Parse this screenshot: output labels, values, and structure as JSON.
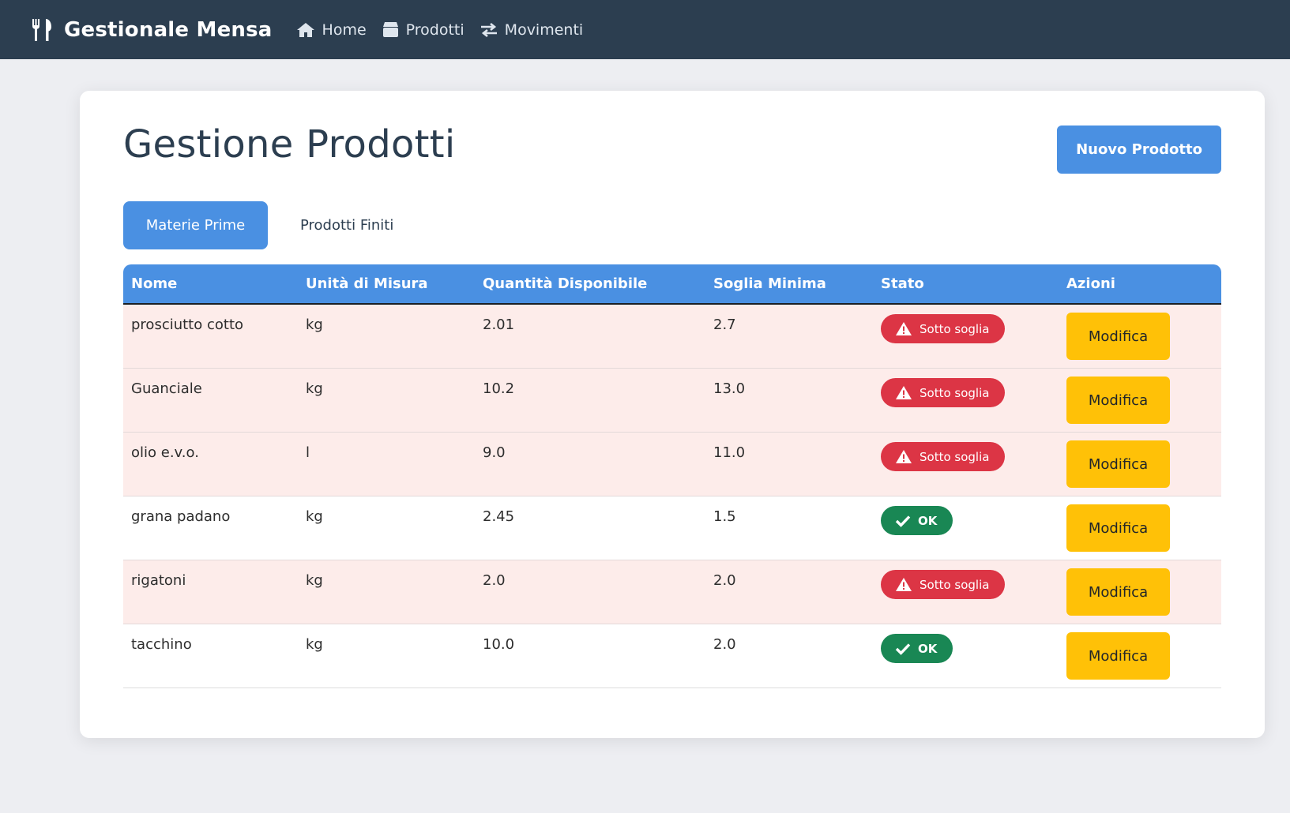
{
  "nav": {
    "brand": "Gestionale Mensa",
    "links": [
      {
        "label": "Home",
        "icon": "home-icon"
      },
      {
        "label": "Prodotti",
        "icon": "box-icon"
      },
      {
        "label": "Movimenti",
        "icon": "exchange-icon"
      }
    ]
  },
  "main": {
    "title": "Gestione Prodotti",
    "new_button": "Nuovo Prodotto",
    "tabs": [
      {
        "label": "Materie Prime",
        "active": true
      },
      {
        "label": "Prodotti Finiti",
        "active": false
      }
    ]
  },
  "table": {
    "headers": [
      "Nome",
      "Unità di Misura",
      "Quantità Disponibile",
      "Soglia Minima",
      "Stato",
      "Azioni"
    ],
    "rows": [
      {
        "nome": "prosciutto cotto",
        "unita": "kg",
        "quantita": "2.01",
        "soglia": "2.7",
        "stato": "Sotto soglia",
        "status": "low",
        "azione": "Modifica"
      },
      {
        "nome": "Guanciale",
        "unita": "kg",
        "quantita": "10.2",
        "soglia": "13.0",
        "stato": "Sotto soglia",
        "status": "low",
        "azione": "Modifica"
      },
      {
        "nome": "olio e.v.o.",
        "unita": "l",
        "quantita": "9.0",
        "soglia": "11.0",
        "stato": "Sotto soglia",
        "status": "low",
        "azione": "Modifica"
      },
      {
        "nome": "grana padano",
        "unita": "kg",
        "quantita": "2.45",
        "soglia": "1.5",
        "stato": "OK",
        "status": "ok",
        "azione": "Modifica"
      },
      {
        "nome": "rigatoni",
        "unita": "kg",
        "quantita": "2.0",
        "soglia": "2.0",
        "stato": "Sotto soglia",
        "status": "low",
        "azione": "Modifica"
      },
      {
        "nome": "tacchino",
        "unita": "kg",
        "quantita": "10.0",
        "soglia": "2.0",
        "stato": "OK",
        "status": "ok",
        "azione": "Modifica"
      }
    ]
  },
  "colors": {
    "navbar": "#2c3e50",
    "primary": "#4a90e2",
    "danger": "#dc3545",
    "success": "#198754",
    "warning": "#ffc107",
    "low_row": "#fdecea"
  }
}
